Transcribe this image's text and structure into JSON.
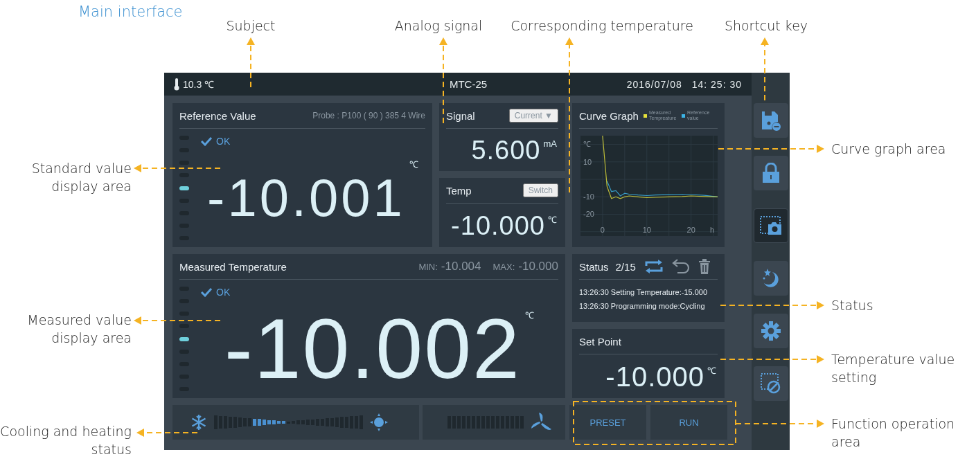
{
  "title": "Main interface",
  "device": {
    "top_bar": {
      "ambient": "10.3 ℃",
      "model": "MTC-25",
      "date": "2016/07/08",
      "time": "14: 25: 30"
    },
    "reference": {
      "title": "Reference Value",
      "probe": "Probe : P100 ( 90 ) 385 4 Wire",
      "check": "OK",
      "value": "-10.001",
      "unit": "℃"
    },
    "signal": {
      "title": "Signal",
      "mode": "Current ▼",
      "value": "5.600",
      "unit": "mA"
    },
    "temp": {
      "title": "Temp",
      "action": "Switch",
      "value": "-10.000",
      "unit": "℃"
    },
    "curve": {
      "title": "Curve Graph",
      "chart_data": {
        "type": "line",
        "xlabel": "h",
        "ylabel": "℃",
        "xlim": [
          -5,
          26
        ],
        "ylim": [
          -32.5,
          25
        ],
        "xticks": [
          0,
          10,
          20
        ],
        "yticks": [
          10,
          -10,
          -20
        ],
        "grid": true,
        "x": [
          0,
          1,
          2,
          3,
          4,
          5,
          6,
          8,
          10,
          12,
          15,
          18,
          20,
          23,
          26
        ],
        "series": [
          {
            "name": "Measured Tempreature",
            "color": "#e6e23a",
            "values": [
              25,
              -4,
              -11,
              -10,
              -11,
              -10,
              -9.5,
              -10,
              -10.5,
              -10.3,
              -10,
              -9.8,
              -9.5,
              -9.8,
              -10
            ]
          },
          {
            "name": "Reference value",
            "color": "#3cb4e6",
            "values": [
              null,
              -1,
              -7,
              -6.5,
              -9.5,
              -8,
              -8.5,
              -9,
              -9.3,
              -9,
              -8.8,
              -8.5,
              -8.7,
              -9.2,
              -10
            ]
          }
        ]
      }
    },
    "measured": {
      "title": "Measured Temperature",
      "min_label": "MIN:",
      "min": "-10.004",
      "max_label": "MAX:",
      "max": "-10.000",
      "check": "OK",
      "value": "-10.002",
      "unit": "℃"
    },
    "status": {
      "title": "Status",
      "count": "2/15",
      "messages": [
        "13:26:30 Setting Temperature:-15.000",
        "13:26:30 Programming mode:Cycling"
      ]
    },
    "set_point": {
      "title": "Set Point",
      "value": "-10.000",
      "unit": "℃"
    },
    "buttons": [
      "PRESET",
      "RUN"
    ],
    "shortcuts": [
      {
        "kind": "save",
        "selected": false
      },
      {
        "kind": "lock",
        "selected": false
      },
      {
        "kind": "screenshot",
        "selected": true
      },
      {
        "kind": "night",
        "selected": false
      },
      {
        "kind": "settings",
        "selected": false
      },
      {
        "kind": "clear",
        "selected": false
      }
    ]
  },
  "callouts": {
    "top": [
      "Subject",
      "Analog signal",
      "Corresponding temperature",
      "Shortcut key"
    ],
    "left": [
      "Standard value display area",
      "Measured value display area",
      "Cooling and heating status"
    ],
    "right": [
      "Curve graph area",
      "Status",
      "Temperature value setting",
      "Function operation area"
    ]
  }
}
